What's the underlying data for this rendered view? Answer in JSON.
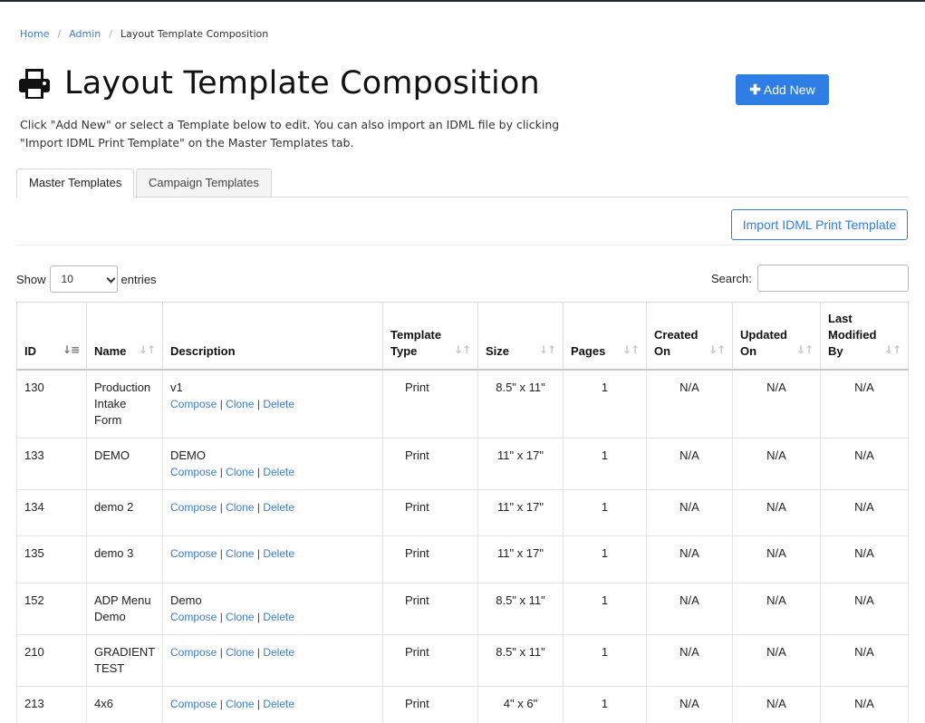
{
  "breadcrumb": {
    "home": "Home",
    "admin": "Admin",
    "current": "Layout Template Composition"
  },
  "page": {
    "title": "Layout Template Composition",
    "add_new": "Add New",
    "intro": "Click \"Add New\" or select a Template below to edit. You can also import an IDML file by clicking \"Import IDML Print Template\" on the Master Templates tab."
  },
  "tabs": {
    "master": "Master Templates",
    "campaign": "Campaign Templates"
  },
  "import_button": "Import IDML Print Template",
  "length": {
    "show": "Show",
    "selected": "10",
    "entries": "entries"
  },
  "search": {
    "label": "Search:",
    "value": ""
  },
  "table": {
    "headers": {
      "id": "ID",
      "name": "Name",
      "description": "Description",
      "type": "Template Type",
      "size": "Size",
      "pages": "Pages",
      "created": "Created On",
      "updated": "Updated On",
      "modified": "Last Modified By"
    },
    "action_labels": {
      "compose": "Compose",
      "clone": "Clone",
      "delete": "Delete",
      "sep": "|"
    },
    "rows": [
      {
        "id": "130",
        "name": "Production Intake Form",
        "description": "v1",
        "type": "Print",
        "size": "8.5\" x 11\"",
        "pages": "1",
        "created": "N/A",
        "updated": "N/A",
        "modified": "N/A"
      },
      {
        "id": "133",
        "name": "DEMO",
        "description": "DEMO",
        "type": "Print",
        "size": "11\" x 17\"",
        "pages": "1",
        "created": "N/A",
        "updated": "N/A",
        "modified": "N/A"
      },
      {
        "id": "134",
        "name": "demo 2",
        "description": "",
        "type": "Print",
        "size": "11\" x 17\"",
        "pages": "1",
        "created": "N/A",
        "updated": "N/A",
        "modified": "N/A"
      },
      {
        "id": "135",
        "name": "demo 3",
        "description": "",
        "type": "Print",
        "size": "11\" x 17\"",
        "pages": "1",
        "created": "N/A",
        "updated": "N/A",
        "modified": "N/A"
      },
      {
        "id": "152",
        "name": "ADP Menu Demo",
        "description": "Demo",
        "type": "Print",
        "size": "8.5\" x 11\"",
        "pages": "1",
        "created": "N/A",
        "updated": "N/A",
        "modified": "N/A"
      },
      {
        "id": "210",
        "name": "GRADIENT TEST",
        "description": "",
        "type": "Print",
        "size": "8.5\" x 11\"",
        "pages": "1",
        "created": "N/A",
        "updated": "N/A",
        "modified": "N/A"
      },
      {
        "id": "213",
        "name": "4x6",
        "description": "",
        "type": "Print",
        "size": "4\" x 6\"",
        "pages": "1",
        "created": "N/A",
        "updated": "N/A",
        "modified": "N/A"
      }
    ]
  },
  "icons": {
    "title": "printer-icon",
    "add": "plus-icon",
    "sort_active": "sort-asc-icon",
    "sort": "sort-icon"
  },
  "colors": {
    "primary": "#2f7ee6",
    "link": "#3b7dd8"
  }
}
